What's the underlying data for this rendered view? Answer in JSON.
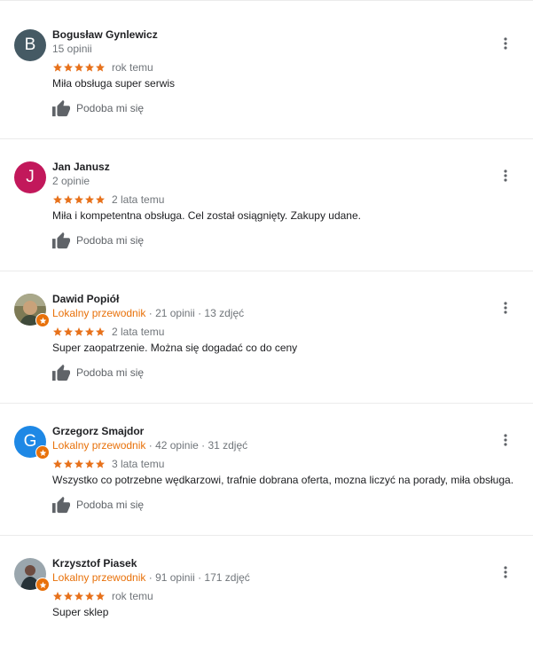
{
  "colors": {
    "guide_orange": "#e8710a",
    "star_orange": "#e7711b",
    "secondary_text": "#70757a"
  },
  "like_label": "Podoba mi się",
  "reviews": [
    {
      "name": "Bogusław Gynlewicz",
      "avatar_letter": "B",
      "avatar_color": "#455a64",
      "is_local_guide": false,
      "local_guide_label": "",
      "meta": "15 opinii",
      "rating": 5,
      "date": "rok temu",
      "text": "Miła obsługa super serwis"
    },
    {
      "name": "Jan Janusz",
      "avatar_letter": "J",
      "avatar_color": "#c2185b",
      "is_local_guide": false,
      "local_guide_label": "",
      "meta": "2 opinie",
      "rating": 5,
      "date": "2 lata temu",
      "text": "Miła i kompetentna obsługa. Cel został osiągnięty. Zakupy udane."
    },
    {
      "name": "Dawid Popiół",
      "avatar_letter": "",
      "avatar_color": "#6d6b4a",
      "is_local_guide": true,
      "local_guide_label": "Lokalny przewodnik",
      "meta": " · 21 opinii · 13 zdjęć",
      "rating": 5,
      "date": "2 lata temu",
      "text": "Super zaopatrzenie. Można się dogadać co do ceny"
    },
    {
      "name": "Grzegorz Smajdor",
      "avatar_letter": "G",
      "avatar_color": "#1e88e5",
      "is_local_guide": true,
      "local_guide_label": "Lokalny przewodnik",
      "meta": " · 42 opinie · 31 zdjęć",
      "rating": 5,
      "date": "3 lata temu",
      "text": "Wszystko co potrzebne wędkarzowi, trafnie dobrana oferta, mozna liczyć na porady, miła obsługa."
    },
    {
      "name": "Krzysztof Piasek",
      "avatar_letter": "",
      "avatar_color": "#7b8a93",
      "is_local_guide": true,
      "local_guide_label": "Lokalny przewodnik",
      "meta": " · 91 opinii · 171 zdjęć",
      "rating": 5,
      "date": "rok temu",
      "text": "Super sklep"
    }
  ]
}
